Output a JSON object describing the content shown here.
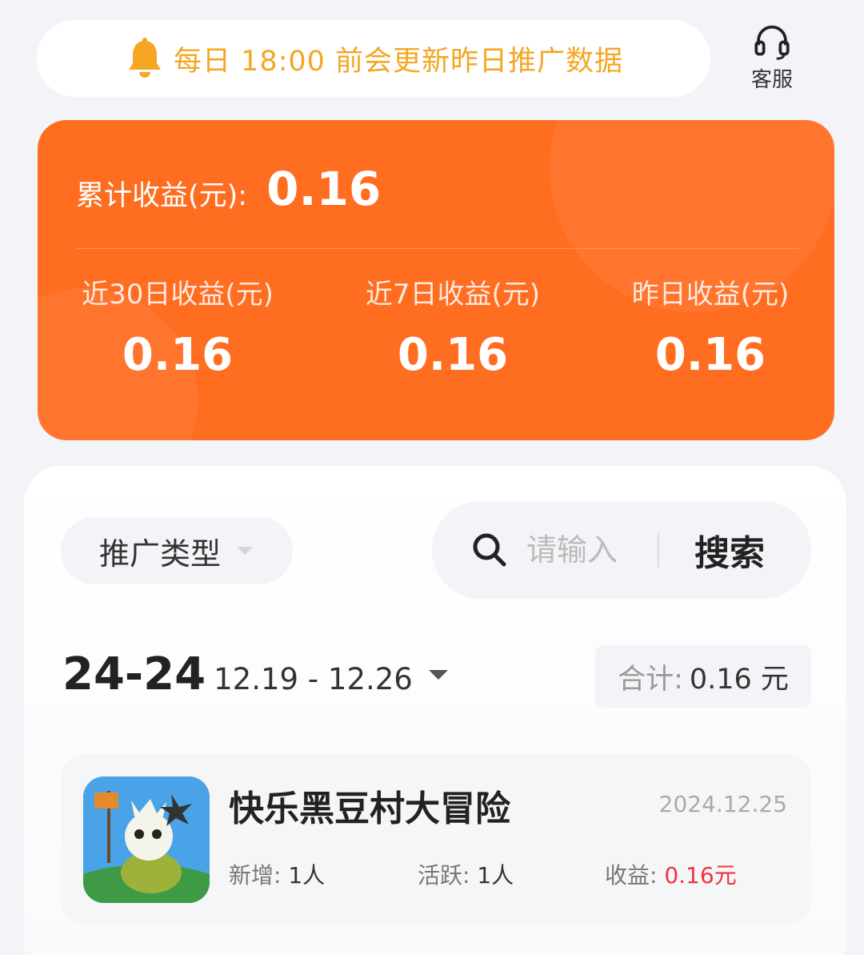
{
  "notice": {
    "text": "每日 18:00 前会更新昨日推广数据"
  },
  "service": {
    "label": "客服"
  },
  "earnings": {
    "total_label": "累计收益(元):",
    "total_value": "0.16",
    "stats": [
      {
        "label": "近30日收益(元)",
        "value": "0.16"
      },
      {
        "label": "近7日收益(元)",
        "value": "0.16"
      },
      {
        "label": "昨日收益(元)",
        "value": "0.16"
      }
    ]
  },
  "filter": {
    "type_label": "推广类型"
  },
  "search": {
    "placeholder": "请输入",
    "button_label": "搜索"
  },
  "period": {
    "year": "24-24",
    "range": "12.19 - 12.26"
  },
  "summary": {
    "label": "合计:",
    "value": "0.16 元"
  },
  "items": [
    {
      "title": "快乐黑豆村大冒险",
      "date": "2024.12.25",
      "new_label": "新增:",
      "new_value": "1人",
      "active_label": "活跃:",
      "active_value": "1人",
      "earn_label": "收益:",
      "earn_value": "0.16元"
    }
  ],
  "colors": {
    "accent": "#ff6d21",
    "notice_text": "#f5a623",
    "earn_red": "#f0333e"
  }
}
